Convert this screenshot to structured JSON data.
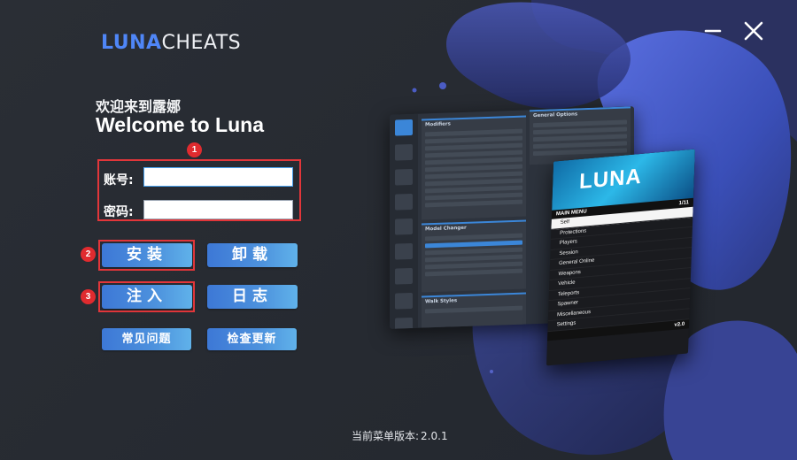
{
  "brand": {
    "part1": "LUNA",
    "part2": "CHEATS"
  },
  "window": {
    "minimize_icon": "minimize-icon",
    "close_icon": "close-icon"
  },
  "greeting": {
    "cn": "欢迎来到露娜",
    "en": "Welcome to Luna"
  },
  "login": {
    "account_label": "账号:",
    "account_value": "",
    "password_label": "密码:",
    "password_value": ""
  },
  "annotations": {
    "badge1": "1",
    "badge2": "2",
    "badge3": "3"
  },
  "buttons": {
    "install": "安装",
    "uninstall": "卸载",
    "inject": "注入",
    "log": "日志",
    "faq": "常见问题",
    "check_update": "检查更新"
  },
  "footer": {
    "version_label": "当前菜单版本:",
    "version_value": "2.0.1"
  },
  "preview": {
    "panel_modifiers": "Modifiers",
    "panel_general": "General Options",
    "panel_model": "Model Changer",
    "panel_walk": "Walk Styles",
    "menu_logo": "LUNA",
    "menu_header": "MAIN MENU",
    "menu_count": "1/11",
    "menu_items": [
      "Self",
      "Protections",
      "Players",
      "Session",
      "General Online",
      "Weapons",
      "Vehicle",
      "Teleports",
      "Spawner",
      "Miscellaneous",
      "Settings"
    ],
    "menu_version": "v2.0"
  },
  "colors": {
    "accent": "#4f86f7",
    "annotation_red": "#e2363a",
    "button_start": "#3d78d6",
    "button_end": "#60b2ea"
  }
}
